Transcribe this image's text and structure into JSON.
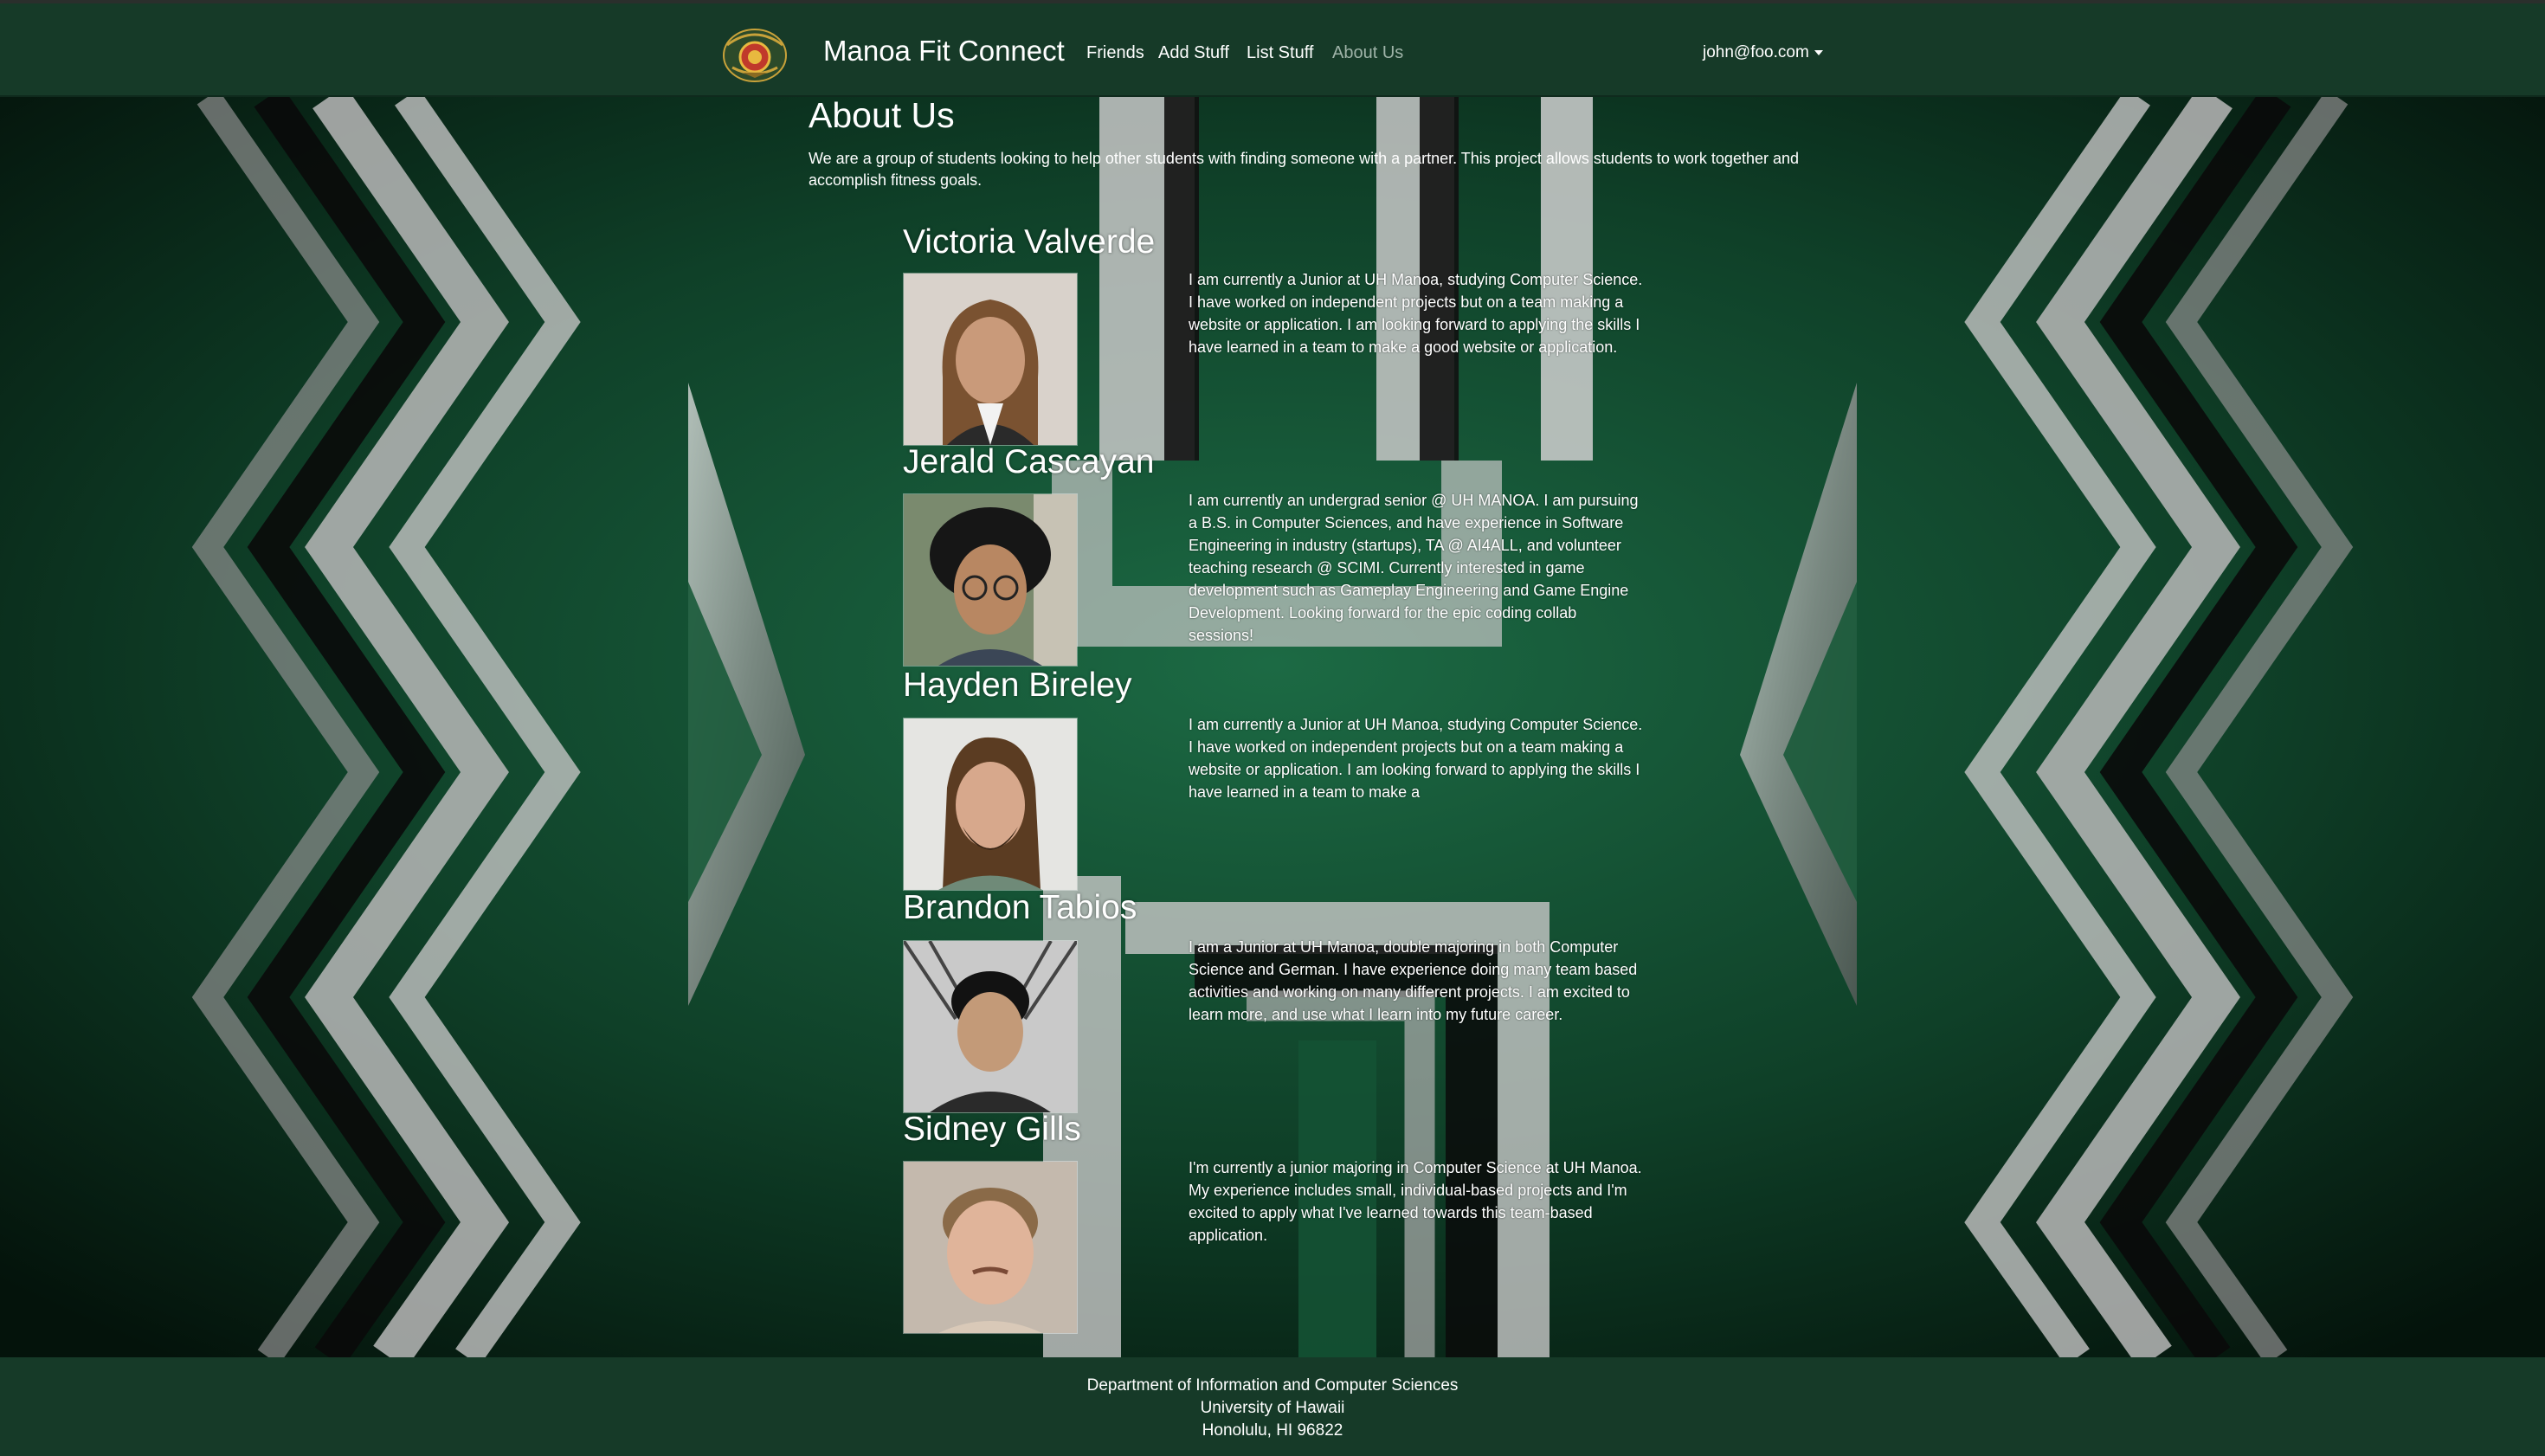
{
  "colors": {
    "navbar": "#163a28",
    "footer": "#163a28",
    "accent_green": "#0e3522",
    "text": "#ffffff"
  },
  "navbar": {
    "logo_icon": "manoa-fit-connect-logo",
    "brand": "Manoa Fit Connect",
    "links": [
      {
        "label": "Friends",
        "active": false
      },
      {
        "label": "Add Stuff",
        "active": false
      },
      {
        "label": "List Stuff",
        "active": false
      },
      {
        "label": "About Us",
        "active": true
      }
    ],
    "user": "john@foo.com"
  },
  "page": {
    "title": "About Us",
    "intro": "We are a group of students looking to help other students with finding someone with a partner. This project allows students to work together and accomplish fitness goals."
  },
  "members": [
    {
      "name": "Victoria Valverde",
      "bio": "I am currently a Junior at UH Manoa, studying Computer Science. I have worked on independent projects but on a team making a website or application. I am looking forward to applying the skills I have learned in a team to make a good website or application."
    },
    {
      "name": "Jerald Cascayan",
      "bio": "I am currently an undergrad senior @ UH MANOA. I am pursuing a B.S. in Computer Sciences, and have experience in Software Engineering in industry (startups), TA @ AI4ALL, and volunteer teaching research @ SCIMI. Currently interested in game development such as Gameplay Engineering and Game Engine Development. Looking forward for the epic coding collab sessions!"
    },
    {
      "name": "Hayden Bireley",
      "bio": "I am currently a Junior at UH Manoa, studying Computer Science. I have worked on independent projects but on a team making a website or application. I am looking forward to applying the skills I have learned in a team to make a"
    },
    {
      "name": "Brandon Tabios",
      "bio": "I am a Junior at UH Manoa, double majoring in both Computer Science and German. I have experience doing many team based activities and working on many different projects. I am excited to learn more, and use what I learn into my future career."
    },
    {
      "name": "Sidney Gills",
      "bio": "I'm currently a junior majoring in Computer Science at UH Manoa. My experience includes small, individual-based projects and I'm excited to apply what I've learned towards this team-based application."
    }
  ],
  "footer": {
    "line1": "Department of Information and Computer Sciences",
    "line2": "University of Hawaii",
    "line3": "Honolulu, HI 96822"
  }
}
